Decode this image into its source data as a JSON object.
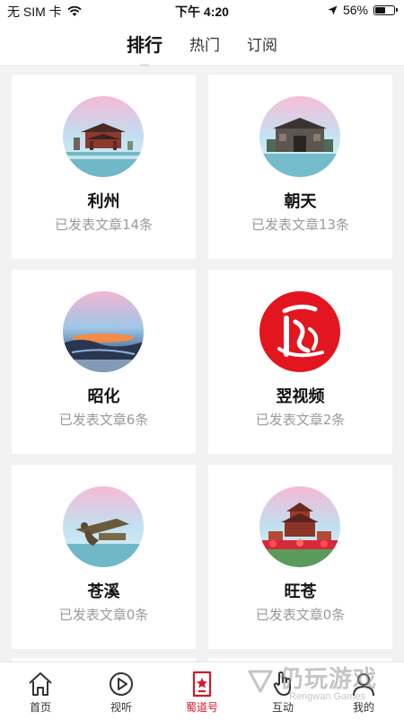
{
  "status": {
    "carrier": "无 SIM 卡",
    "time": "下午 4:20",
    "battery": "56%",
    "battery_level": 0.56
  },
  "tabs": [
    {
      "label": "排行",
      "active": true
    },
    {
      "label": "热门",
      "active": false
    },
    {
      "label": "订阅",
      "active": false
    }
  ],
  "cards": [
    {
      "title": "利州",
      "subtitle": "已发表文章14条",
      "image": "pavilion"
    },
    {
      "title": "朝天",
      "subtitle": "已发表文章13条",
      "image": "gate"
    },
    {
      "title": "昭化",
      "subtitle": "已发表文章6条",
      "image": "sunset-landscape"
    },
    {
      "title": "翌视频",
      "subtitle": "已发表文章2条",
      "image": "calligraphy-logo"
    },
    {
      "title": "苍溪",
      "subtitle": "已发表文章0条",
      "image": "bridge-sculpture"
    },
    {
      "title": "旺苍",
      "subtitle": "已发表文章0条",
      "image": "pagoda-flowers"
    }
  ],
  "bottom_nav": [
    {
      "label": "首页",
      "icon": "home-icon",
      "active": false
    },
    {
      "label": "视听",
      "icon": "play-icon",
      "active": false
    },
    {
      "label": "蜀道号",
      "icon": "star-bookmark-icon",
      "active": true
    },
    {
      "label": "互动",
      "icon": "hand-icon",
      "active": false
    },
    {
      "label": "我的",
      "icon": "user-icon",
      "active": false
    }
  ],
  "watermark": {
    "title": "仍玩游戏",
    "subtitle": "Rengwan Games"
  },
  "colors": {
    "accent": "#d0192b",
    "background": "#f2f2f2",
    "card": "#ffffff",
    "subtitle": "#9a9a9a"
  }
}
